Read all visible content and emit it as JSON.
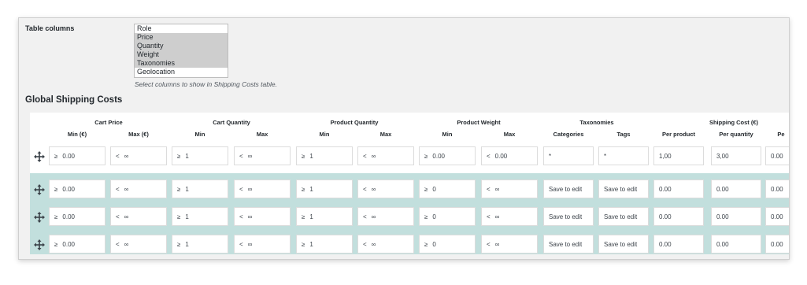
{
  "settings": {
    "table_columns_label": "Table columns",
    "options": [
      {
        "label": "Role",
        "selected": false
      },
      {
        "label": "Price",
        "selected": true
      },
      {
        "label": "Quantity",
        "selected": true
      },
      {
        "label": "Weight",
        "selected": true
      },
      {
        "label": "Taxonomies",
        "selected": true
      },
      {
        "label": "Geolocation",
        "selected": false
      }
    ],
    "hint": "Select columns to show in Shipping Costs table."
  },
  "section_title": "Global Shipping Costs",
  "table": {
    "groups": [
      "Cart Price",
      "Cart Quantity",
      "Product Quantity",
      "Product Weight",
      "Taxonomies",
      "Shipping Cost (€)"
    ],
    "subheaders": [
      "Min (€)",
      "Max (€)",
      "Min",
      "Max",
      "Min",
      "Max",
      "Min",
      "Max",
      "Categories",
      "Tags",
      "Per product",
      "Per quantity",
      "Pe"
    ],
    "rows": [
      {
        "cells": [
          {
            "prefix": "≥",
            "value": "0.00"
          },
          {
            "prefix": "<",
            "value": "∞"
          },
          {
            "prefix": "≥",
            "value": "1"
          },
          {
            "prefix": "<",
            "value": "∞"
          },
          {
            "prefix": "≥",
            "value": "1"
          },
          {
            "prefix": "<",
            "value": "∞"
          },
          {
            "prefix": "≥",
            "value": "0.00"
          },
          {
            "prefix": "<",
            "value": "0.00"
          },
          {
            "prefix": "",
            "value": "*"
          },
          {
            "prefix": "",
            "value": "*"
          },
          {
            "prefix": "",
            "value": "1,00"
          },
          {
            "prefix": "",
            "value": "3,00"
          },
          {
            "prefix": "",
            "value": "0.00"
          }
        ]
      },
      {
        "cells": [
          {
            "prefix": "≥",
            "value": "0.00"
          },
          {
            "prefix": "<",
            "value": "∞"
          },
          {
            "prefix": "≥",
            "value": "1"
          },
          {
            "prefix": "<",
            "value": "∞"
          },
          {
            "prefix": "≥",
            "value": "1"
          },
          {
            "prefix": "<",
            "value": "∞"
          },
          {
            "prefix": "≥",
            "value": "0"
          },
          {
            "prefix": "<",
            "value": "∞"
          },
          {
            "prefix": "",
            "value": "Save to edit"
          },
          {
            "prefix": "",
            "value": "Save to edit"
          },
          {
            "prefix": "",
            "value": "0.00"
          },
          {
            "prefix": "",
            "value": "0.00"
          },
          {
            "prefix": "",
            "value": "0.00"
          }
        ]
      },
      {
        "cells": [
          {
            "prefix": "≥",
            "value": "0.00"
          },
          {
            "prefix": "<",
            "value": "∞"
          },
          {
            "prefix": "≥",
            "value": "1"
          },
          {
            "prefix": "<",
            "value": "∞"
          },
          {
            "prefix": "≥",
            "value": "1"
          },
          {
            "prefix": "<",
            "value": "∞"
          },
          {
            "prefix": "≥",
            "value": "0"
          },
          {
            "prefix": "<",
            "value": "∞"
          },
          {
            "prefix": "",
            "value": "Save to edit"
          },
          {
            "prefix": "",
            "value": "Save to edit"
          },
          {
            "prefix": "",
            "value": "0.00"
          },
          {
            "prefix": "",
            "value": "0.00"
          },
          {
            "prefix": "",
            "value": "0.00"
          }
        ]
      },
      {
        "cells": [
          {
            "prefix": "≥",
            "value": "0.00"
          },
          {
            "prefix": "<",
            "value": "∞"
          },
          {
            "prefix": "≥",
            "value": "1"
          },
          {
            "prefix": "<",
            "value": "∞"
          },
          {
            "prefix": "≥",
            "value": "1"
          },
          {
            "prefix": "<",
            "value": "∞"
          },
          {
            "prefix": "≥",
            "value": "0"
          },
          {
            "prefix": "<",
            "value": "∞"
          },
          {
            "prefix": "",
            "value": "Save to edit"
          },
          {
            "prefix": "",
            "value": "Save to edit"
          },
          {
            "prefix": "",
            "value": "0.00"
          },
          {
            "prefix": "",
            "value": "0.00"
          },
          {
            "prefix": "",
            "value": "0.00"
          }
        ]
      }
    ]
  },
  "colors": {
    "panel_bg": "#f1f1f1",
    "selected_option": "#cecece",
    "row_band": "#c2dfdd"
  },
  "icons": {
    "row_handle": "move-arrows-icon"
  }
}
